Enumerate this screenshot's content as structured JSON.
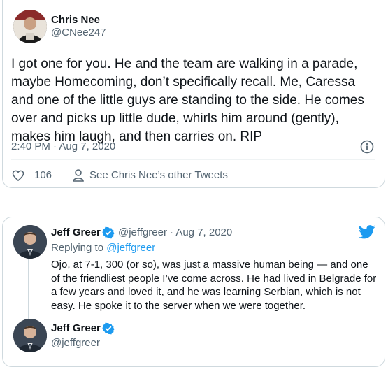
{
  "tweet1": {
    "author_name": "Chris Nee",
    "author_handle": "@CNee247",
    "text": "I got one for you. He and the team are walking in a parade, maybe Homecoming, don’t specifically recall. Me, Caressa and one of the little guys are standing to the side. He comes over and picks up little dude, whirls him around (gently), makes him laugh, and then carries on. RIP",
    "timestamp": "2:40 PM · Aug 7, 2020",
    "like_count": "106",
    "see_other_label": "See Chris Nee’s other Tweets"
  },
  "tweet2": {
    "author_name": "Jeff Greer",
    "author_handle": "@jeffgreer",
    "date": "· Aug 7, 2020",
    "replying_prefix": "Replying to",
    "replying_handle": "@jeffgreer",
    "text": "Ojo, at 7-1, 300 (or so), was just a massive human being — and one of the friendliest people I’ve come across. He had lived in Belgrade for a few years and loved it, and he was learning Serbian, which is not easy. He spoke it to the server when we were together."
  },
  "tweet3": {
    "author_name": "Jeff Greer",
    "author_handle": "@jeffgreer"
  },
  "colors": {
    "accent": "#1d9bf0",
    "secondary_text": "#536471",
    "border": "#cfd9de"
  },
  "icons": [
    "heart-icon",
    "person-icon",
    "info-icon",
    "verified-badge-icon",
    "twitter-bird-icon"
  ]
}
